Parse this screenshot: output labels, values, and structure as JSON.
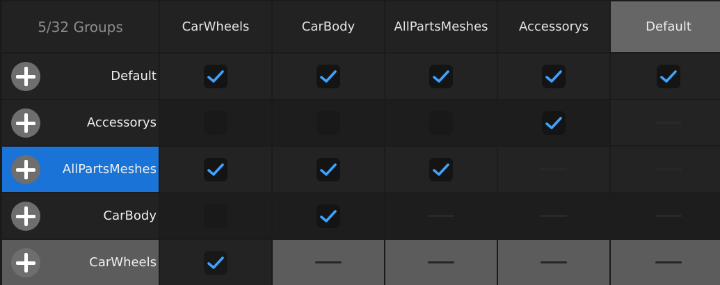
{
  "header": {
    "group_count": "5/32 Groups",
    "columns": [
      "CarWheels",
      "CarBody",
      "AllPartsMeshes",
      "Accessorys",
      "Default"
    ]
  },
  "rows": [
    {
      "label": "Default",
      "cells": [
        "checked",
        "checked",
        "checked",
        "checked",
        "checked"
      ]
    },
    {
      "label": "Accessorys",
      "cells": [
        "unchecked",
        "unchecked",
        "unchecked",
        "checked",
        "dash"
      ]
    },
    {
      "label": "AllPartsMeshes",
      "cells": [
        "checked",
        "checked",
        "checked",
        "dash",
        "dash"
      ]
    },
    {
      "label": "CarBody",
      "cells": [
        "unchecked",
        "checked",
        "dash",
        "dash",
        "dash"
      ]
    },
    {
      "label": "CarWheels",
      "cells": [
        "checked",
        "dash",
        "dash",
        "dash",
        "dash"
      ]
    }
  ],
  "selected_row": "AllPartsMeshes",
  "active_column": "Default",
  "colors": {
    "background": "#1b1b1b",
    "cell_light": "#232323",
    "cell_dark": "#1d1d1d",
    "highlight_gray": "#5c5c5c",
    "selected_blue": "#1a73d6",
    "check_blue": "#3ea3ff"
  },
  "icons": {
    "row_add": "add-icon",
    "check": "checkmark-icon"
  }
}
